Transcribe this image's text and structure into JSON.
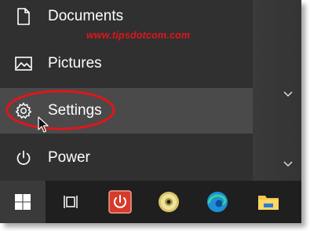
{
  "start_menu": {
    "watermark": "www.tipsdotcom.com",
    "items": [
      {
        "label": "Documents",
        "icon": "document-icon"
      },
      {
        "label": "Pictures",
        "icon": "pictures-icon"
      },
      {
        "label": "Settings",
        "icon": "gear-icon",
        "highlighted": true
      },
      {
        "label": "Power",
        "icon": "power-icon"
      }
    ]
  },
  "taskbar": {
    "buttons": [
      {
        "name": "start",
        "icon": "windows-logo-icon"
      },
      {
        "name": "task-view",
        "icon": "task-view-icon"
      },
      {
        "name": "red-app",
        "icon": "red-power-app-icon"
      },
      {
        "name": "disc-app",
        "icon": "disc-icon"
      },
      {
        "name": "edge",
        "icon": "edge-icon"
      },
      {
        "name": "file-explorer",
        "icon": "folder-icon"
      }
    ]
  },
  "colors": {
    "annotation": "#e0161b",
    "menu_bg": "#303030",
    "hover_bg": "#4a4a4a",
    "taskbar_bg": "#1f1f1f"
  }
}
